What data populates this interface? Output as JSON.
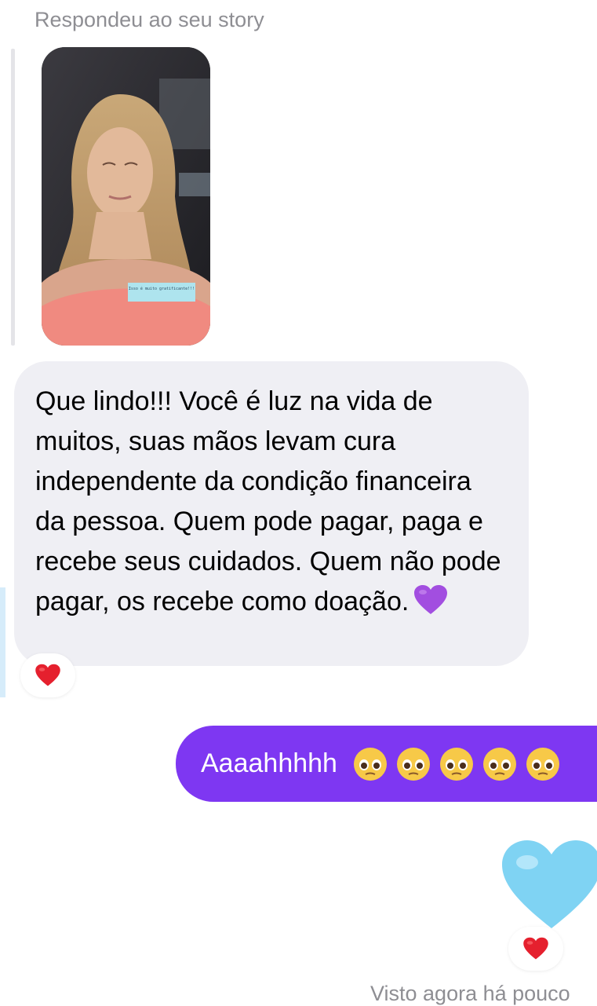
{
  "conversation": {
    "reply_label": "Respondeu ao seu story",
    "story": {
      "sticker_text": "Isso é muito gratificante!!!"
    },
    "incoming_message": {
      "text": "Que lindo!!! Você é luz na vida de muitos, suas mãos levam cura independente da condição financeira da pessoa. Quem pode pagar, paga e recebe seus cuidados. Quem não pode pagar, os recebe como doação.",
      "emoji_icon": "purple-heart-icon",
      "reaction_icon": "red-heart-icon"
    },
    "outgoing_message": {
      "text": "Aaaahhhhh",
      "emoji_icon": "pleading-face-icon",
      "emoji_count": 5
    },
    "outgoing_heart": {
      "emoji_icon": "light-blue-heart-icon",
      "reaction_icon": "red-heart-icon"
    },
    "seen_status": "Visto agora há pouco"
  },
  "colors": {
    "incoming_bubble": "#efeff4",
    "outgoing_bubble": "#7e37f2",
    "secondary_text": "#8e8e93",
    "heart_red": "#e5202e",
    "heart_blue": "#7fd3f3",
    "heart_purple": "#a24ee0"
  }
}
